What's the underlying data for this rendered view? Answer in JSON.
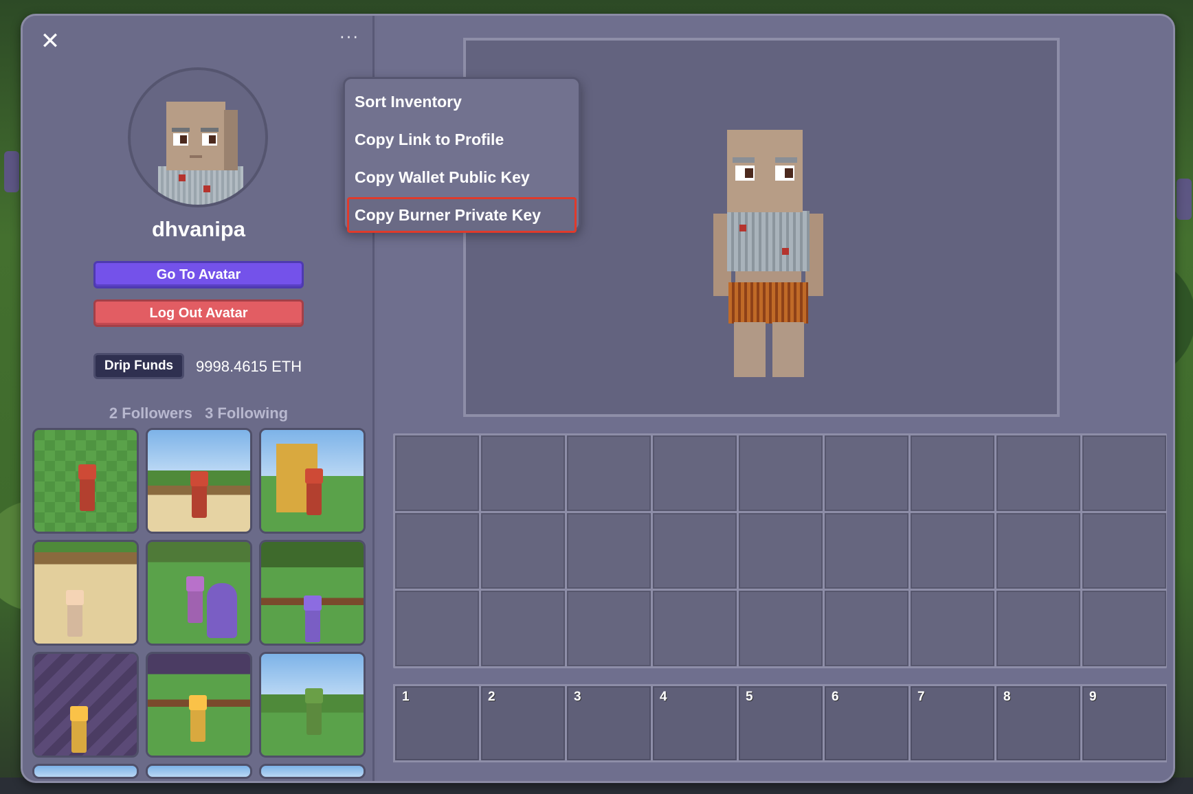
{
  "profile": {
    "close_icon": "close-icon",
    "more_icon": "more-horizontal-icon",
    "more_label": "···",
    "close_label": "✕",
    "username": "dhvanipa",
    "go_to_avatar": "Go To Avatar",
    "log_out_avatar": "Log Out Avatar",
    "drip_funds": "Drip Funds",
    "balance": "9998.4615 ETH",
    "followers": "2 Followers",
    "following": "3 Following",
    "colors": {
      "go_button": "#7452ea",
      "logout_button": "#e25d63",
      "panel": "#6e6e8c"
    }
  },
  "menu": {
    "items": [
      {
        "label": "Sort Inventory"
      },
      {
        "label": "Copy Link to Profile"
      },
      {
        "label": "Copy Wallet Public Key"
      },
      {
        "label": "Copy Burner Private Key",
        "highlighted": true
      }
    ],
    "highlight_color": "#e03a2b"
  },
  "screenshots": {
    "count_visible": 9,
    "partial_row": 3
  },
  "inventory": {
    "rows": 3,
    "columns": 9
  },
  "hotbar": {
    "slots": [
      "1",
      "2",
      "3",
      "4",
      "5",
      "6",
      "7",
      "8",
      "9"
    ]
  }
}
